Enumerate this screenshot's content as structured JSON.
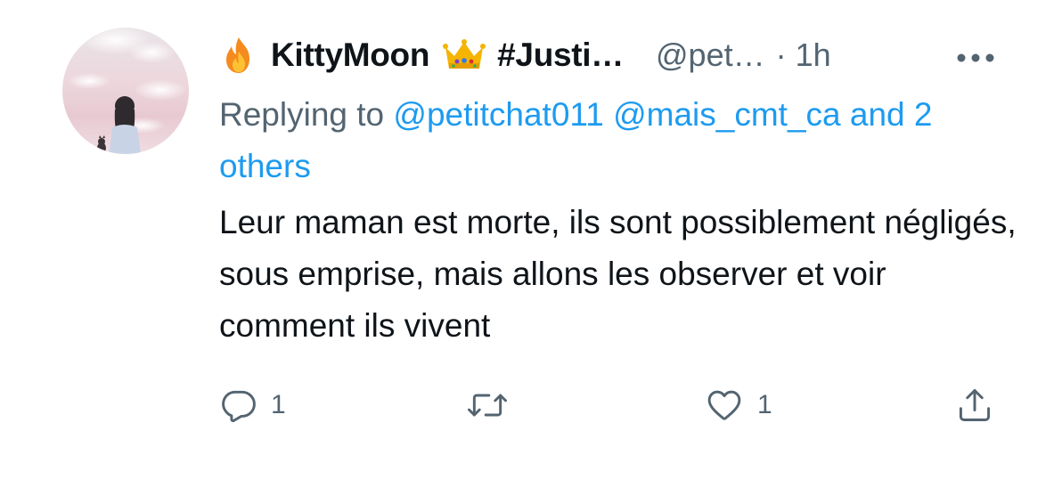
{
  "tweet": {
    "display_name": "KittyMoon",
    "display_name_suffix": "#Justi…",
    "handle": "@pet…",
    "separator": "·",
    "time": "1h",
    "replying_prefix": "Replying to",
    "replying_to": [
      "@petitchat011",
      "@mais_cmt_ca"
    ],
    "replying_and": "and",
    "replying_others": "2 others",
    "text": "Leur maman est morte, ils sont possiblement négligés, sous emprise, mais allons les observer et voir comment ils vivent",
    "emoji_left": "fire-emoji",
    "emoji_right": "crown-emoji"
  },
  "actions": {
    "reply_count": "1",
    "retweet_count": "",
    "like_count": "1",
    "icons": [
      "reply-icon",
      "retweet-icon",
      "like-icon",
      "share-icon"
    ]
  },
  "colors": {
    "text": "#0f1419",
    "secondary": "#536471",
    "link": "#1d9bf0"
  }
}
